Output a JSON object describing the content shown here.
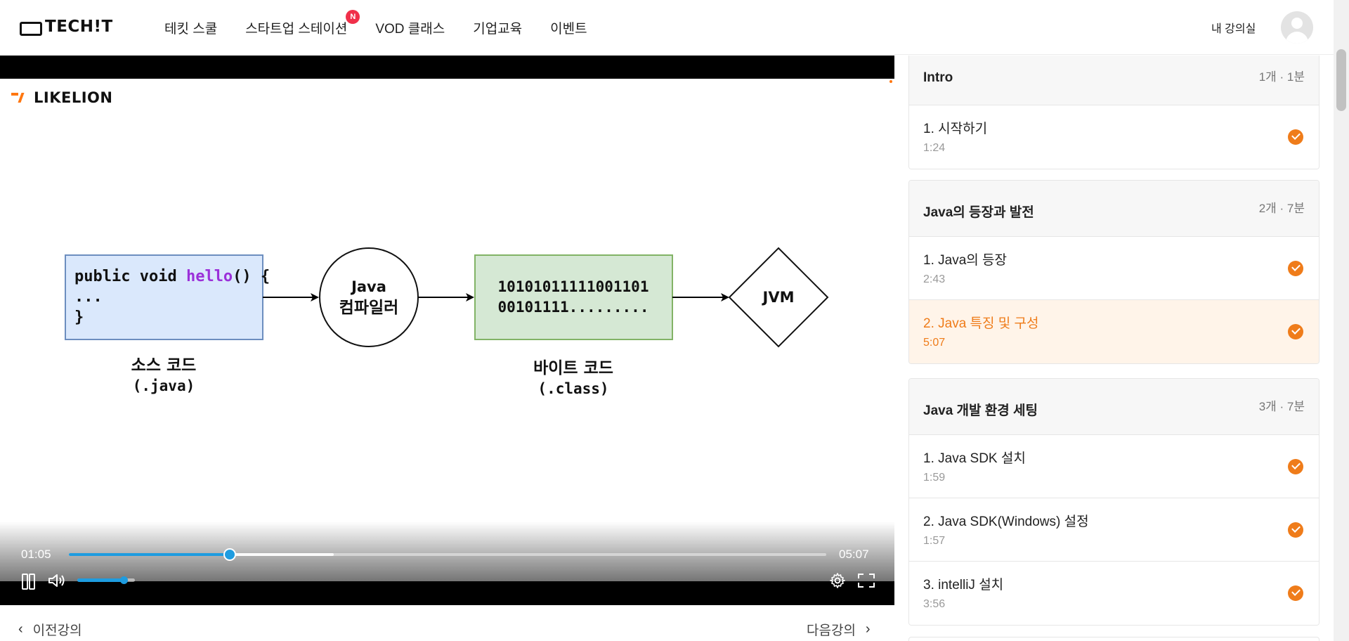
{
  "header": {
    "logo_text": "TECH!T",
    "nav": [
      {
        "label": "테킷 스쿨"
      },
      {
        "label": "스타트업 스테이션",
        "badge": "N"
      },
      {
        "label": "VOD 클래스"
      },
      {
        "label": "기업교육"
      },
      {
        "label": "이벤트"
      }
    ],
    "my_classroom": "내 강의실"
  },
  "video": {
    "brand": "LIKELION",
    "diagram": {
      "code_line1_prefix": "public void ",
      "code_line1_fn": "hello",
      "code_line1_suffix": "() {",
      "code_line2": "...",
      "code_line3": "}",
      "compiler_line1": "Java",
      "compiler_line2": "컴파일러",
      "bytes_line1": "10101011111001101",
      "bytes_line2": "00101111.........",
      "jvm": "JVM",
      "source_label1": "소스 코드",
      "source_label2": "(.java)",
      "byte_label1": "바이트 코드",
      "byte_label2": "(.class)"
    },
    "current_time": "01:05",
    "total_time": "05:07",
    "progress_fraction": 0.212,
    "buffered_fraction": 0.35,
    "volume_fraction": 0.8,
    "accent_color": "#1e9ce0"
  },
  "navigation": {
    "prev": "이전강의",
    "next": "다음강의"
  },
  "sidebar": {
    "accent_color": "#ef7c1a",
    "sections": [
      {
        "title": "Intro",
        "meta": "1개 · 1분",
        "lessons": [
          {
            "title": "1. 시작하기",
            "duration": "1:24",
            "completed": true
          }
        ]
      },
      {
        "title": "Java의 등장과 발전",
        "meta": "2개 · 7분",
        "lessons": [
          {
            "title": "1. Java의 등장",
            "duration": "2:43",
            "completed": true
          },
          {
            "title": "2. Java 특징 및 구성",
            "duration": "5:07",
            "completed": true,
            "active": true
          }
        ]
      },
      {
        "title": "Java 개발 환경 세팅",
        "meta": "3개 · 7분",
        "lessons": [
          {
            "title": "1. Java SDK 설치",
            "duration": "1:59",
            "completed": true
          },
          {
            "title": "2. Java SDK(Windows) 설정",
            "duration": "1:57",
            "completed": true
          },
          {
            "title": "3. intelliJ 설치",
            "duration": "3:56",
            "completed": true
          }
        ]
      }
    ]
  }
}
